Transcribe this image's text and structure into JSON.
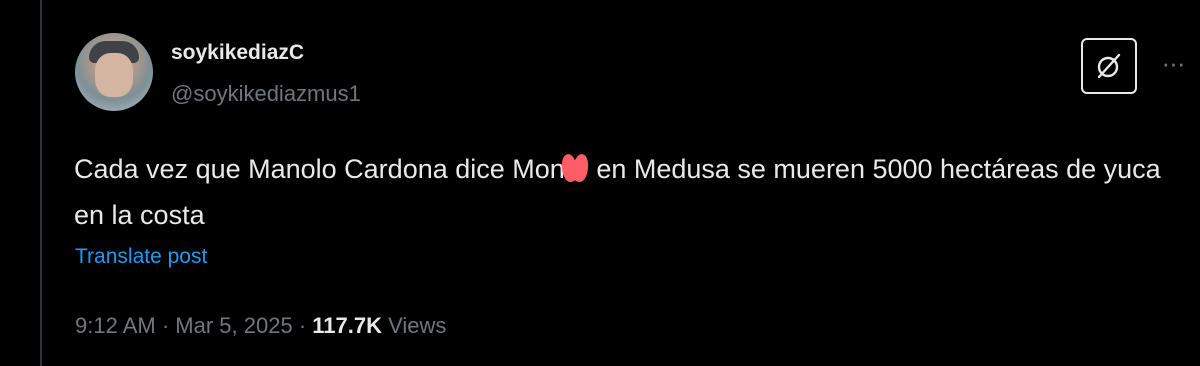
{
  "author": {
    "display_name": "soykikediazC",
    "handle": "@soykikediazmus1"
  },
  "tweet": {
    "text_part1": "Cada vez que Manolo Cardona dice Mon",
    "text_part2": " en Medusa se mueren 5000 hectáreas de yuca en la costa",
    "redaction_color": "#ff5e66"
  },
  "actions": {
    "translate_label": "Translate post",
    "more_label": "···"
  },
  "meta": {
    "time": "9:12 AM",
    "separator": "·",
    "date": "Mar 5, 2025",
    "views_count": "117.7K",
    "views_label": "Views"
  },
  "colors": {
    "background": "#000000",
    "text": "#e7e9ea",
    "muted": "#71767b",
    "link": "#1d9bf0"
  },
  "icons": {
    "grok": "grok-icon",
    "more": "more-icon"
  }
}
